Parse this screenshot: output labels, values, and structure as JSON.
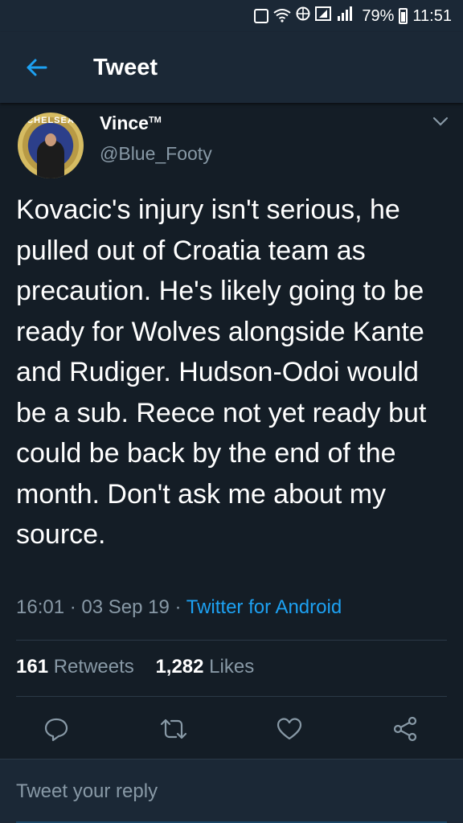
{
  "status_bar": {
    "battery": "79%",
    "time": "11:51"
  },
  "app_bar": {
    "title": "Tweet"
  },
  "tweet": {
    "display_name": "Vince",
    "display_name_mark": "TM",
    "handle": "@Blue_Footy",
    "avatar_text": "CHELSEA",
    "text": "Kovacic's injury isn't serious, he pulled out of Croatia team as precaution. He's likely going to be ready for Wolves alongside Kante and Rudiger. Hudson-Odoi would be a sub. Reece not yet ready but could be back by the end of the month. Don't ask me about my source.",
    "time": "16:01",
    "date": "03 Sep 19",
    "source": "Twitter for Android",
    "retweets_count": "161",
    "retweets_label": "Retweets",
    "likes_count": "1,282",
    "likes_label": "Likes"
  },
  "reply": {
    "placeholder": "Tweet your reply"
  },
  "colors": {
    "background": "#141d26",
    "bar": "#1b2836",
    "accent": "#1da1f2",
    "secondary_text": "#8899a6"
  },
  "icons": {
    "back": "arrow-left-icon",
    "menu": "chevron-down-icon",
    "reply": "comment-icon",
    "retweet": "retweet-icon",
    "like": "heart-icon",
    "share": "share-icon"
  }
}
